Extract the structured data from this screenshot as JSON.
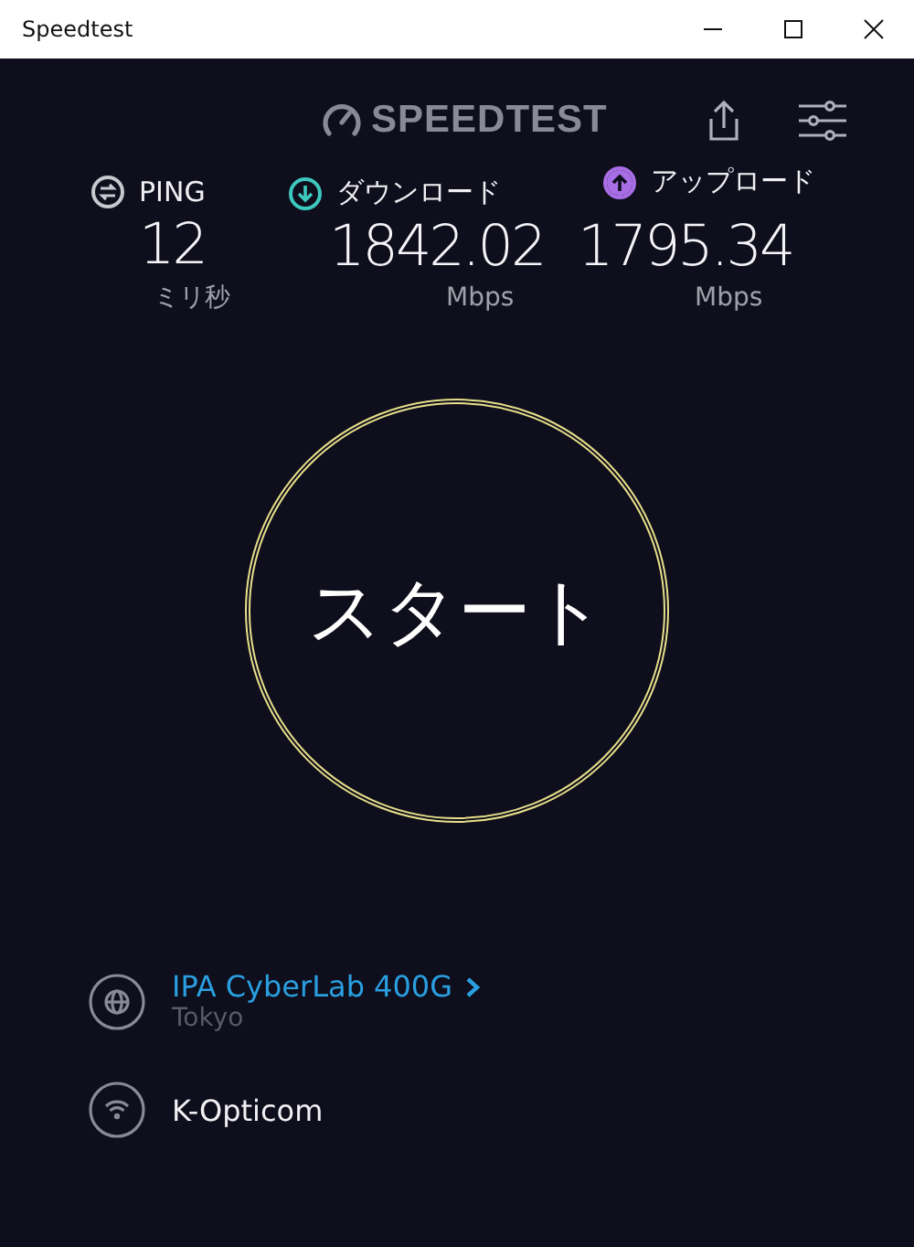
{
  "window": {
    "title": "Speedtest"
  },
  "header": {
    "logo": "SPEEDTEST"
  },
  "metrics": [
    {
      "kind": "ping",
      "label": "PING",
      "value": "12",
      "unit": "ミリ秒",
      "color": "#c8c8d0"
    },
    {
      "kind": "download",
      "label": "ダウンロード",
      "value": "1842.02",
      "unit": "Mbps",
      "color": "#3ec9c0"
    },
    {
      "kind": "upload",
      "label": "アップロード",
      "value": "1795.34",
      "unit": "Mbps",
      "color": "#a86ee6"
    }
  ],
  "start_button": {
    "label": "スタート"
  },
  "server": {
    "name": "IPA CyberLab 400G",
    "location": "Tokyo"
  },
  "provider": {
    "name": "K-Opticom"
  }
}
